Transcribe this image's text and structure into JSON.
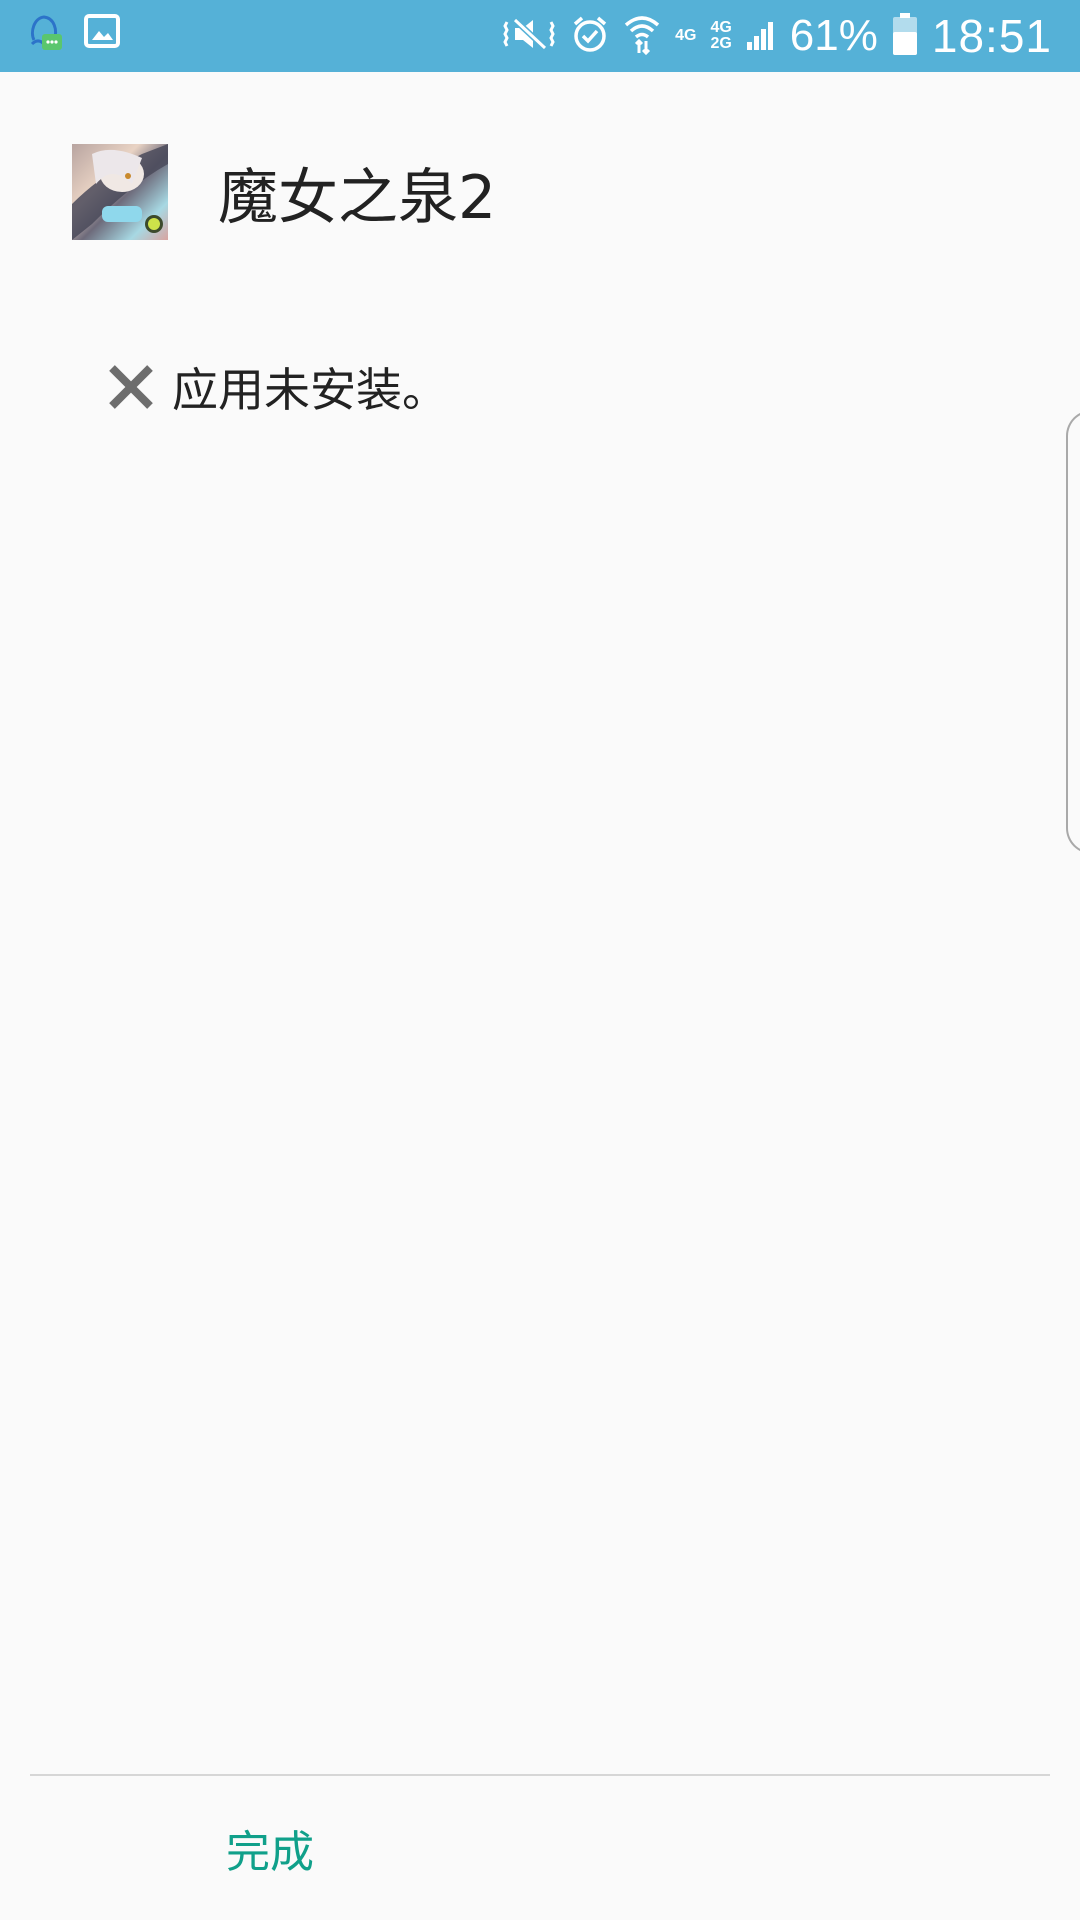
{
  "status_bar": {
    "left_icons": [
      "qq-notification-icon",
      "image-notification-icon"
    ],
    "right_icons": [
      "vibrate-icon",
      "alarm-icon",
      "wifi-icon",
      "signal-icon",
      "battery-icon"
    ],
    "net_label_1": "4G",
    "net_label_2_top": "4G",
    "net_label_2_bottom": "2G",
    "battery_percent": "61%",
    "time": "18:51",
    "background": "#55b1d7"
  },
  "app": {
    "name": "魔女之泉2",
    "icon": "app-icon"
  },
  "result": {
    "icon": "close-icon",
    "message": "应用未安装。"
  },
  "footer": {
    "done_label": "完成",
    "accent": "#10a08a"
  }
}
